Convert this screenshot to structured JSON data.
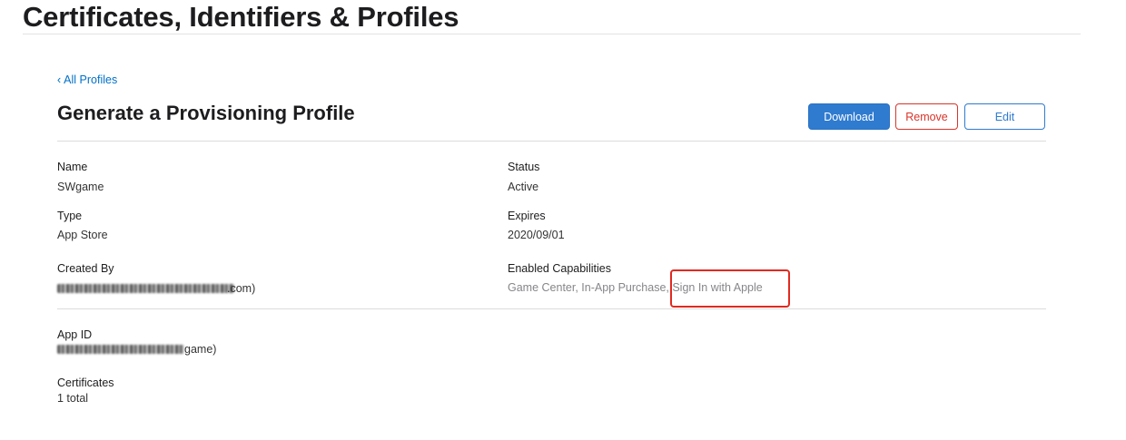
{
  "header": {
    "title": "Certificates, Identifiers & Profiles"
  },
  "nav": {
    "back_chevron": "‹",
    "back_label": "All Profiles"
  },
  "profile": {
    "heading": "Generate a Provisioning Profile",
    "actions": {
      "download_label": "Download",
      "remove_label": "Remove",
      "edit_label": "Edit"
    },
    "fields": {
      "name": {
        "label": "Name",
        "value": "SWgame"
      },
      "status": {
        "label": "Status",
        "value": "Active"
      },
      "type": {
        "label": "Type",
        "value": "App Store"
      },
      "expires": {
        "label": "Expires",
        "value": "2020/09/01"
      },
      "created_by": {
        "label": "Created By",
        "value_suffix": ".com)"
      },
      "enabled_capabilities": {
        "label": "Enabled Capabilities",
        "value_part1": "Game Center, In-App Purchase,",
        "value_part2": " Sign In with Apple"
      },
      "app_id": {
        "label": "App ID",
        "value_suffix": "game)"
      },
      "certificates": {
        "label": "Certificates",
        "value": "1 total"
      }
    }
  },
  "colors": {
    "link": "#0070c9",
    "primary_button": "#2f7bd0",
    "danger": "#d8352a",
    "annotation": "#e02a20"
  }
}
